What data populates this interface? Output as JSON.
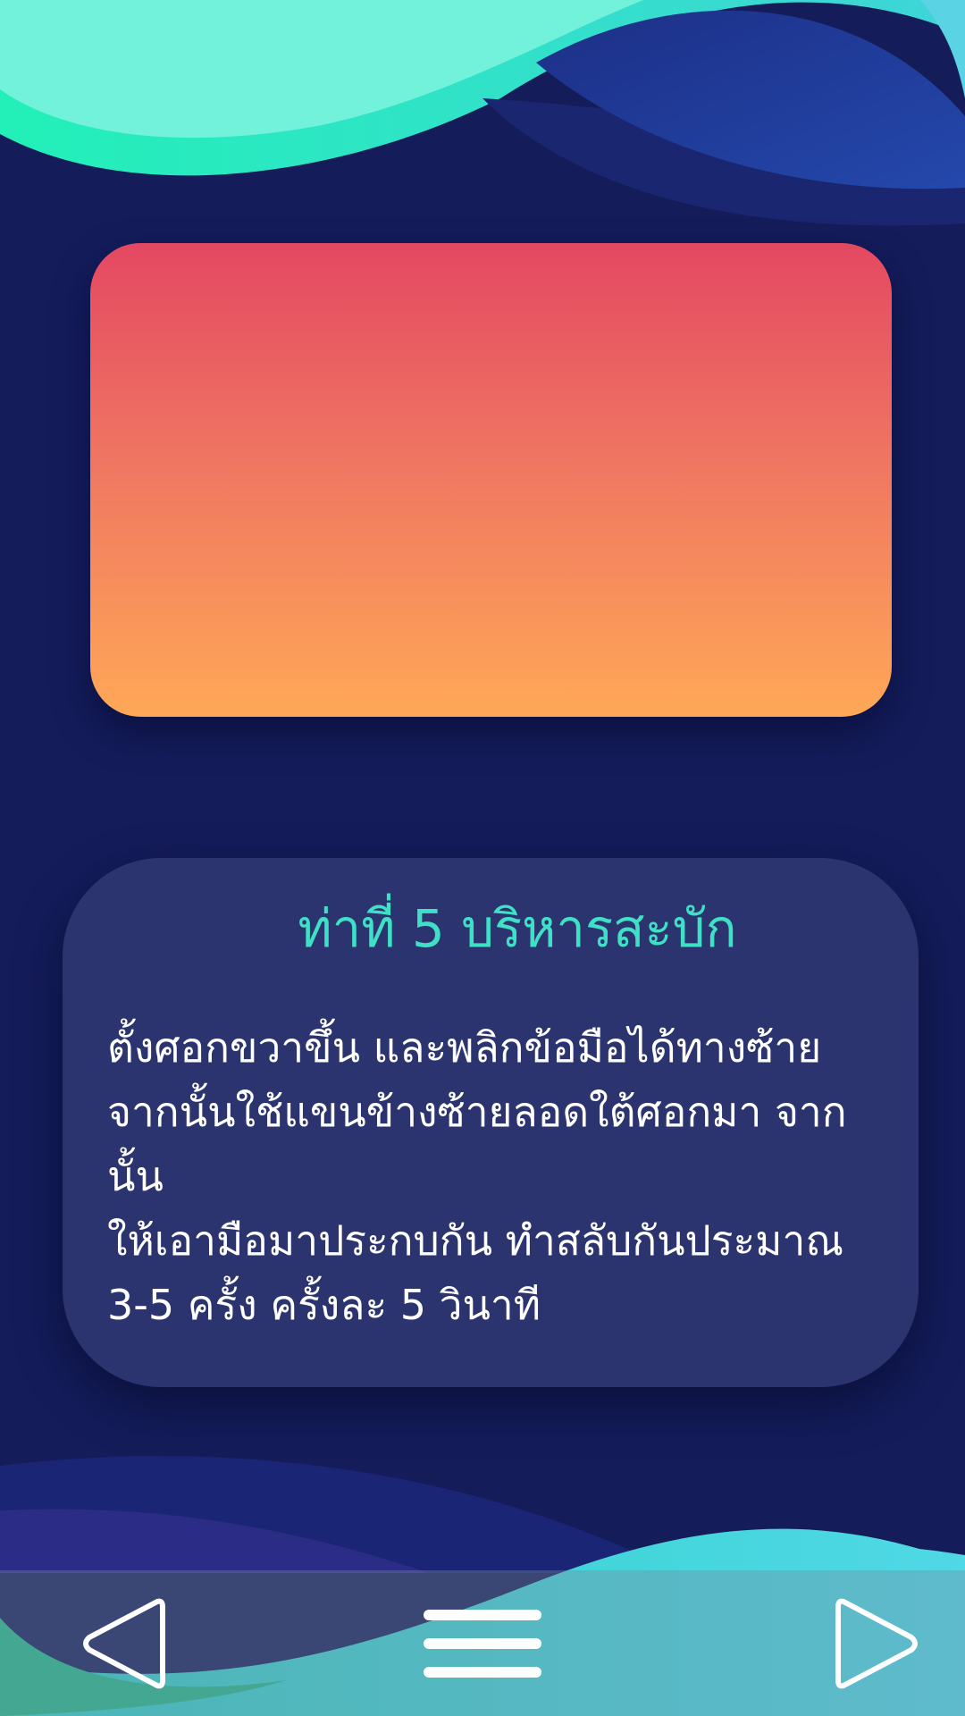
{
  "exercise": {
    "title": "ท่าที่ 5 บริหารสะบัก",
    "description": "   ตั้งศอกขวาขึ้น และพลิกข้อมือได้ทางซ้าย\nจากนั้นใช้แขนข้างซ้ายลอดใต้ศอกมา จากนั้น\nให้เอามือมาประกบกัน ทำสลับกันประมาณ\n3-5 ครั้ง ครั้งละ 5  วินาที"
  },
  "nav": {
    "prev_icon": "triangle-left-outline-icon",
    "menu_icon": "hamburger-menu-icon",
    "next_icon": "triangle-right-outline-icon"
  },
  "colors": {
    "background": "#141c5a",
    "card_gradient_top": "#e44862",
    "card_gradient_bottom": "#ffa857",
    "info_card": "#2b346e",
    "title_accent": "#3fe0c6",
    "wave_teal": "#2de8c0",
    "wave_blue": "#2244a8"
  }
}
